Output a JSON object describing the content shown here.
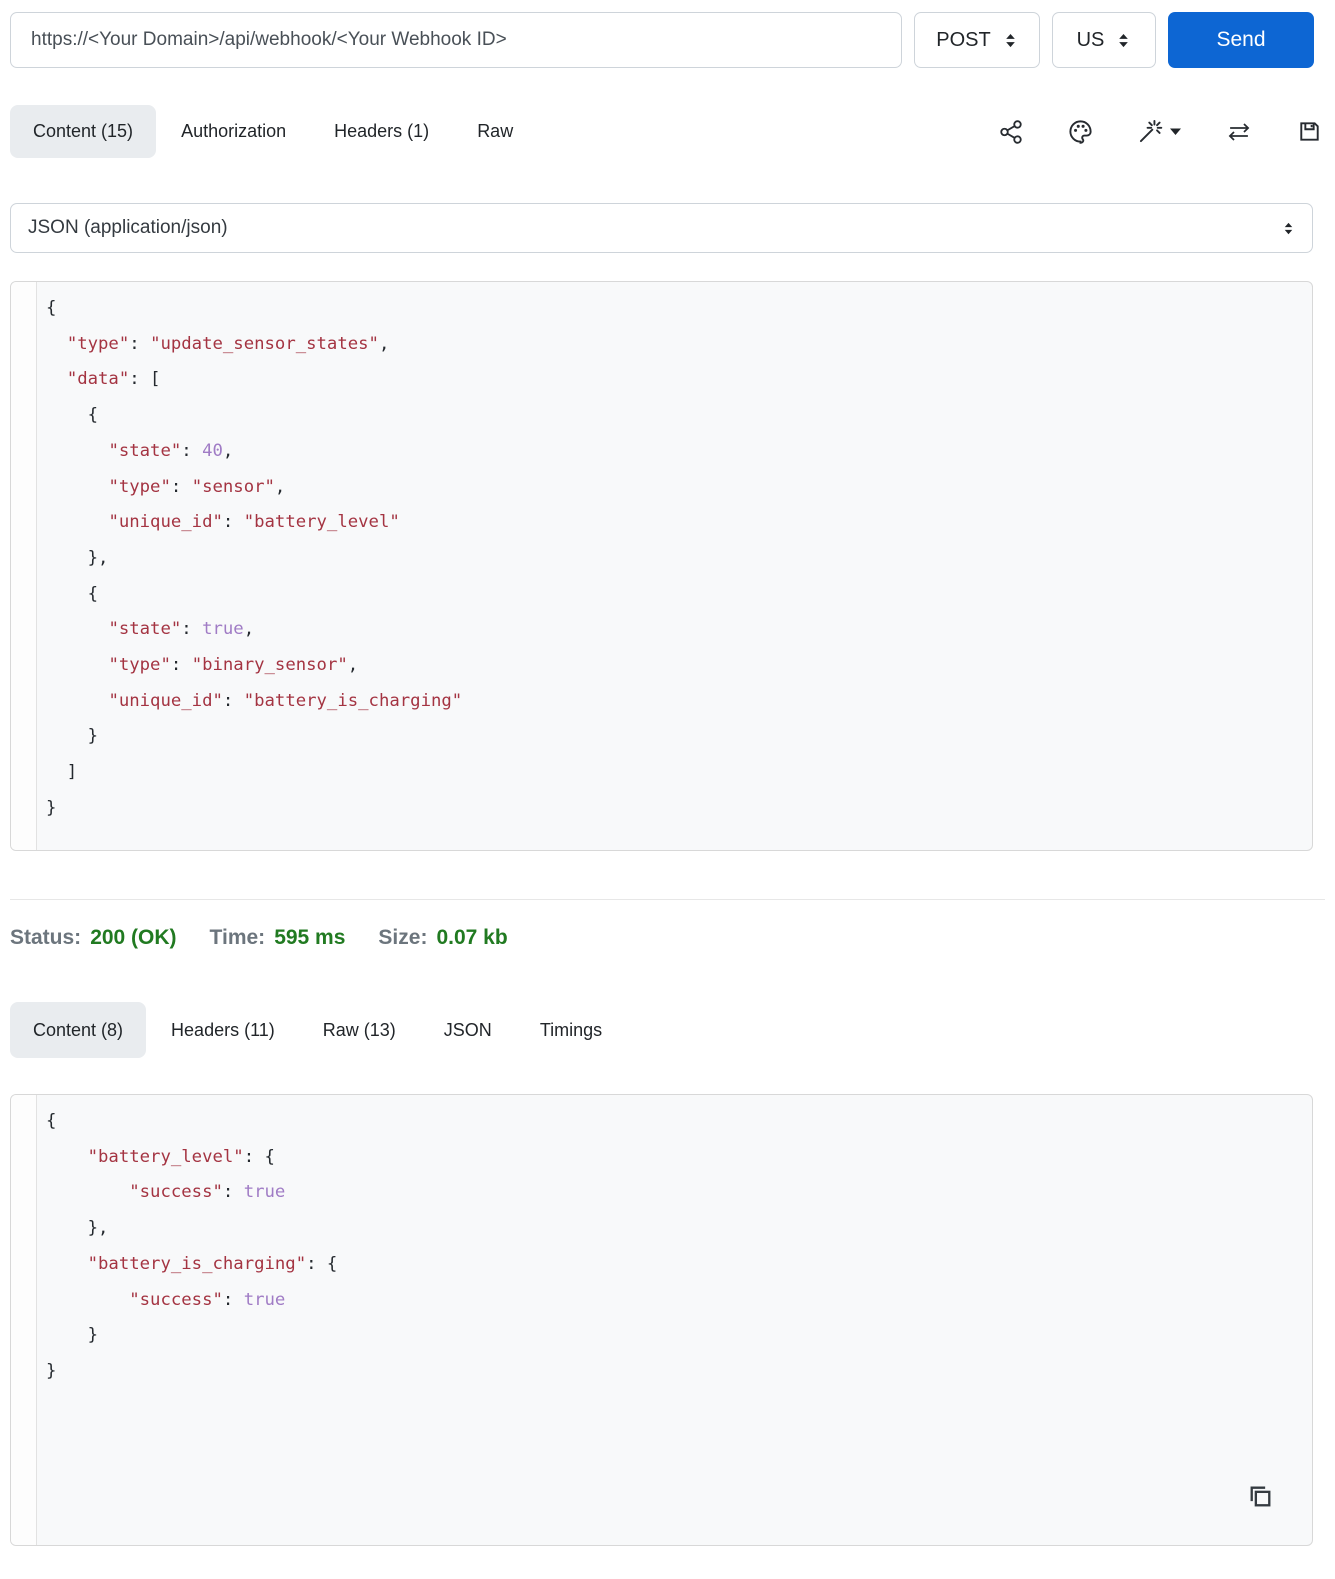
{
  "request_bar": {
    "url": "https://<Your Domain>/api/webhook/<Your Webhook ID>",
    "method": "POST",
    "locale": "US",
    "send_label": "Send"
  },
  "request_tabs": {
    "items": [
      {
        "label": "Content (15)",
        "active": true
      },
      {
        "label": "Authorization",
        "active": false
      },
      {
        "label": "Headers (1)",
        "active": false
      },
      {
        "label": "Raw",
        "active": false
      }
    ]
  },
  "toolbar": {
    "icons": [
      "share-icon",
      "palette-icon",
      "magic-wand-icon",
      "swap-arrows-icon",
      "save-icon"
    ]
  },
  "body_type": {
    "selected": "JSON (application/json)"
  },
  "request_body": {
    "language": "json",
    "lines": [
      [
        {
          "t": "{"
        }
      ],
      [
        {
          "t": "  "
        },
        {
          "t": "\"type\"",
          "c": "r"
        },
        {
          "t": ": "
        },
        {
          "t": "\"update_sensor_states\"",
          "c": "r"
        },
        {
          "t": ","
        }
      ],
      [
        {
          "t": "  "
        },
        {
          "t": "\"data\"",
          "c": "r"
        },
        {
          "t": ": ["
        }
      ],
      [
        {
          "t": "    {"
        }
      ],
      [
        {
          "t": "      "
        },
        {
          "t": "\"state\"",
          "c": "r"
        },
        {
          "t": ": "
        },
        {
          "t": "40",
          "c": "v"
        },
        {
          "t": ","
        }
      ],
      [
        {
          "t": "      "
        },
        {
          "t": "\"type\"",
          "c": "r"
        },
        {
          "t": ": "
        },
        {
          "t": "\"sensor\"",
          "c": "r"
        },
        {
          "t": ","
        }
      ],
      [
        {
          "t": "      "
        },
        {
          "t": "\"unique_id\"",
          "c": "r"
        },
        {
          "t": ": "
        },
        {
          "t": "\"battery_level\"",
          "c": "r"
        }
      ],
      [
        {
          "t": "    },"
        }
      ],
      [
        {
          "t": "    {"
        }
      ],
      [
        {
          "t": "      "
        },
        {
          "t": "\"state\"",
          "c": "r"
        },
        {
          "t": ": "
        },
        {
          "t": "true",
          "c": "v"
        },
        {
          "t": ","
        }
      ],
      [
        {
          "t": "      "
        },
        {
          "t": "\"type\"",
          "c": "r"
        },
        {
          "t": ": "
        },
        {
          "t": "\"binary_sensor\"",
          "c": "r"
        },
        {
          "t": ","
        }
      ],
      [
        {
          "t": "      "
        },
        {
          "t": "\"unique_id\"",
          "c": "r"
        },
        {
          "t": ": "
        },
        {
          "t": "\"battery_is_charging\"",
          "c": "r"
        }
      ],
      [
        {
          "t": "    }"
        }
      ],
      [
        {
          "t": "  ]"
        }
      ],
      [
        {
          "t": "}"
        }
      ]
    ]
  },
  "status_bar": {
    "status_label": "Status:",
    "status_value": "200 (OK)",
    "time_label": "Time:",
    "time_value": "595 ms",
    "size_label": "Size:",
    "size_value": "0.07 kb"
  },
  "response_tabs": {
    "items": [
      {
        "label": "Content (8)",
        "active": true
      },
      {
        "label": "Headers (11)",
        "active": false
      },
      {
        "label": "Raw (13)",
        "active": false
      },
      {
        "label": "JSON",
        "active": false
      },
      {
        "label": "Timings",
        "active": false
      }
    ]
  },
  "response_body": {
    "language": "json",
    "lines": [
      [
        {
          "t": "{"
        }
      ],
      [
        {
          "t": "    "
        },
        {
          "t": "\"battery_level\"",
          "c": "r"
        },
        {
          "t": ": {"
        }
      ],
      [
        {
          "t": "        "
        },
        {
          "t": "\"success\"",
          "c": "r"
        },
        {
          "t": ": "
        },
        {
          "t": "true",
          "c": "v"
        }
      ],
      [
        {
          "t": "    },"
        }
      ],
      [
        {
          "t": "    "
        },
        {
          "t": "\"battery_is_charging\"",
          "c": "r"
        },
        {
          "t": ": {"
        }
      ],
      [
        {
          "t": "        "
        },
        {
          "t": "\"success\"",
          "c": "r"
        },
        {
          "t": ": "
        },
        {
          "t": "true",
          "c": "v"
        }
      ],
      [
        {
          "t": "    }"
        }
      ],
      [
        {
          "t": "}"
        }
      ]
    ]
  },
  "colors": {
    "accent_blue": "#0d66d3",
    "status_green": "#217a21",
    "label_gray": "#6c757d",
    "active_tab_bg": "#e9ecef",
    "syntax_key_string": "#a43442",
    "syntax_literal": "#a07cc5",
    "code_bg": "#f8f9fa"
  }
}
